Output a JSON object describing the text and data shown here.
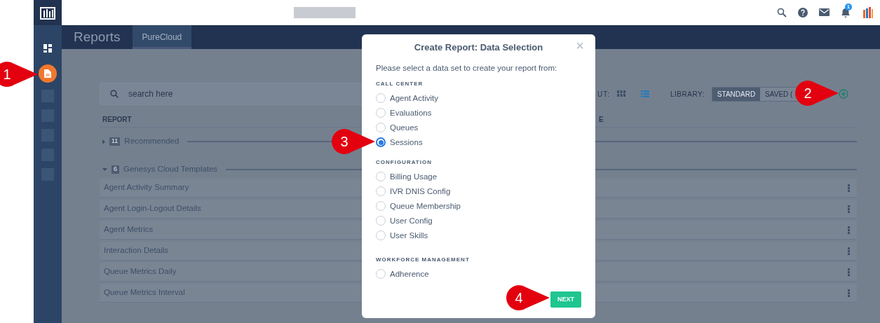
{
  "top_bar": {
    "notification_count": "1"
  },
  "sidebar": {
    "items": [
      {
        "kind": "dashboard",
        "selected": false
      },
      {
        "kind": "reports",
        "selected": true
      },
      {
        "kind": "blurred",
        "selected": false
      },
      {
        "kind": "blurred",
        "selected": false
      },
      {
        "kind": "blurred",
        "selected": false
      },
      {
        "kind": "blurred",
        "selected": false
      },
      {
        "kind": "blurred",
        "selected": false
      }
    ]
  },
  "header": {
    "title": "Reports",
    "tabs": [
      {
        "label": "PureCloud",
        "selected": true
      }
    ]
  },
  "toolbar": {
    "search_placeholder": "search here",
    "layout_label": "UT:",
    "layouts": [
      {
        "kind": "grid",
        "selected": false
      },
      {
        "kind": "list",
        "selected": true
      }
    ],
    "library_label": "LIBRARY:",
    "library_options": [
      {
        "label": "STANDARD",
        "selected": true
      },
      {
        "label": "SAVED (",
        "selected": false
      }
    ]
  },
  "table": {
    "columns": [
      "REPORT",
      "E"
    ],
    "groups": [
      {
        "name": "Recommended",
        "count": "11",
        "expanded": false
      },
      {
        "name": "Genesys Cloud Templates",
        "count": "6",
        "expanded": true,
        "rows": [
          "Agent Activity Summary",
          "Agent Login-Logout Details",
          "Agent Metrics",
          "Interaction Details",
          "Queue Metrics Daily",
          "Queue Metrics Interval"
        ]
      }
    ]
  },
  "dialog": {
    "title": "Create Report: Data Selection",
    "close": "×",
    "prompt": "Please select a data set to create your report from:",
    "sections": [
      {
        "heading": "CALL CENTER",
        "options": [
          {
            "label": "Agent Activity",
            "selected": false
          },
          {
            "label": "Evaluations",
            "selected": false
          },
          {
            "label": "Queues",
            "selected": false
          },
          {
            "label": "Sessions",
            "selected": true
          }
        ]
      },
      {
        "heading": "CONFIGURATION",
        "options": [
          {
            "label": "Billing Usage",
            "selected": false
          },
          {
            "label": "IVR DNIS Config",
            "selected": false
          },
          {
            "label": "Queue Membership",
            "selected": false
          },
          {
            "label": "User Config",
            "selected": false
          },
          {
            "label": "User Skills",
            "selected": false
          }
        ]
      },
      {
        "heading": "WORKFORCE MANAGEMENT",
        "options": [
          {
            "label": "Adherence",
            "selected": false
          }
        ]
      }
    ],
    "next_button": "NEXT"
  },
  "callouts": [
    {
      "label": "1"
    },
    {
      "label": "2"
    },
    {
      "label": "3"
    },
    {
      "label": "4"
    }
  ]
}
